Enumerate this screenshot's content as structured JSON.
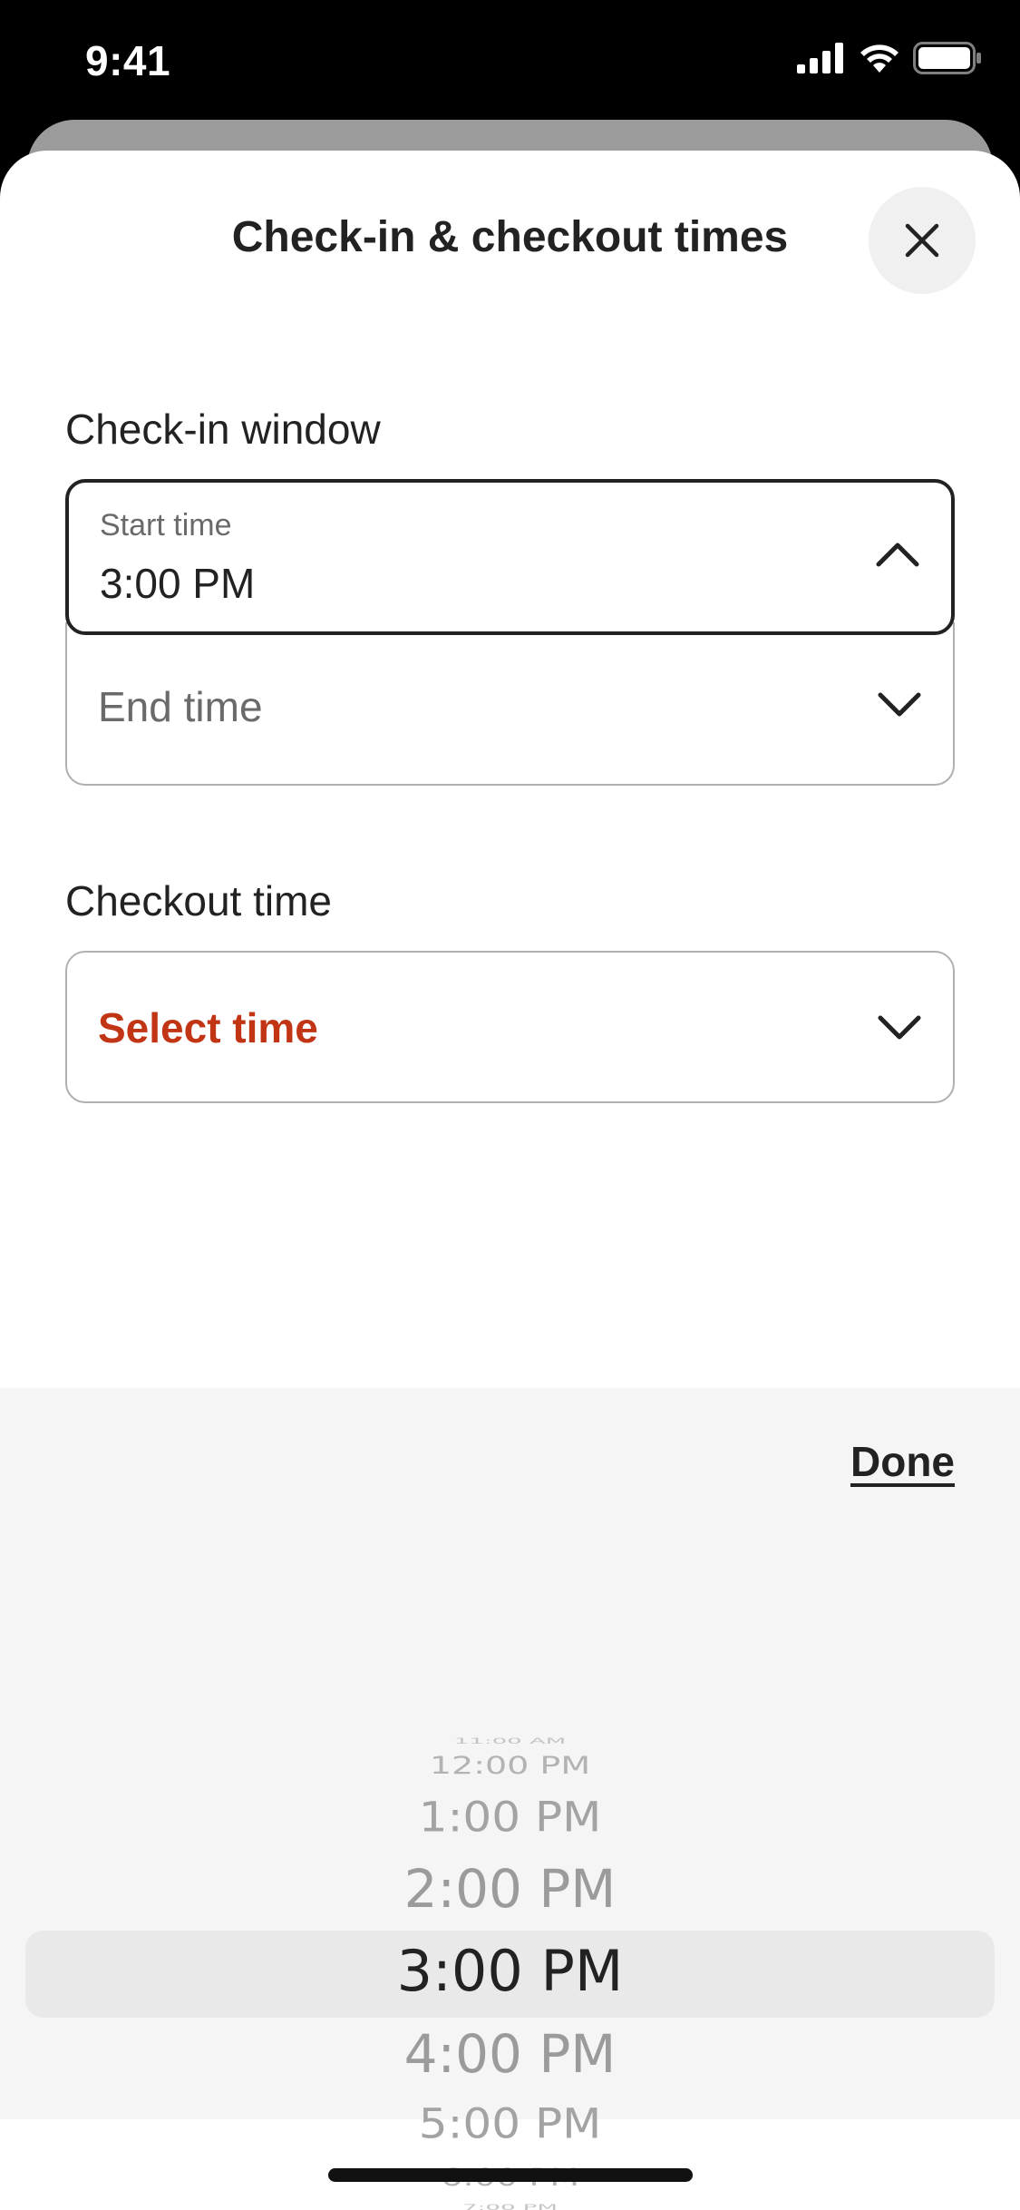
{
  "status_bar": {
    "time": "9:41"
  },
  "header": {
    "title": "Check-in & checkout times"
  },
  "checkin": {
    "section_label": "Check-in window",
    "start": {
      "label": "Start time",
      "value": "3:00 PM"
    },
    "end": {
      "placeholder": "End time"
    }
  },
  "checkout": {
    "section_label": "Checkout time",
    "value": "Select time"
  },
  "picker": {
    "done_label": "Done",
    "items": [
      "11:00 AM",
      "12:00 PM",
      "1:00 PM",
      "2:00 PM",
      "3:00 PM",
      "4:00 PM",
      "5:00 PM",
      "6:00 PM",
      "7:00 PM"
    ],
    "selected": "3:00 PM"
  },
  "colors": {
    "error": "#c13515",
    "text": "#222222",
    "muted": "#6a6a6a"
  }
}
